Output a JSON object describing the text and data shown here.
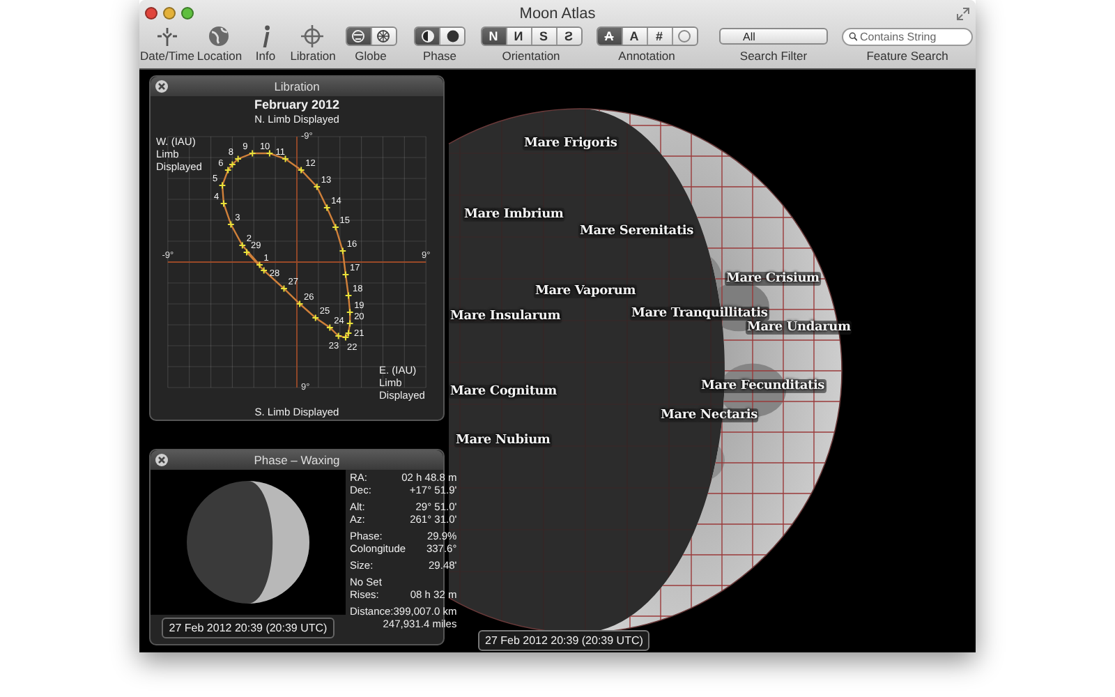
{
  "window": {
    "title": "Moon Atlas"
  },
  "toolbar": [
    {
      "kind": "button",
      "label": "Date/Time"
    },
    {
      "kind": "button",
      "label": "Location"
    },
    {
      "kind": "button",
      "label": "Info"
    },
    {
      "kind": "button",
      "label": "Libration"
    },
    {
      "kind": "segmented",
      "label": "Globe",
      "segments": [
        {
          "kind": "icon",
          "selected": true
        },
        {
          "kind": "icon",
          "selected": false
        }
      ]
    },
    {
      "kind": "segmented",
      "label": "Phase",
      "segments": [
        {
          "kind": "icon",
          "selected": true
        },
        {
          "kind": "icon",
          "selected": false
        }
      ]
    },
    {
      "kind": "segmented",
      "label": "Orientation",
      "segments": [
        {
          "kind": "text",
          "text": "N",
          "selected": true
        },
        {
          "kind": "text",
          "text": "И",
          "selected": false
        },
        {
          "kind": "text",
          "text": "S",
          "selected": false
        },
        {
          "kind": "text",
          "text": "Ƨ",
          "selected": false
        }
      ]
    },
    {
      "kind": "segmented",
      "label": "Annotation",
      "segments": [
        {
          "kind": "text",
          "text": "A",
          "struck": true,
          "selected": true
        },
        {
          "kind": "text",
          "text": "A",
          "struck": false,
          "selected": false
        },
        {
          "kind": "text",
          "text": "#",
          "struck": false,
          "selected": false
        },
        {
          "kind": "icon",
          "selected": false
        }
      ]
    },
    {
      "kind": "popup",
      "label": "Search Filter",
      "value": "All"
    },
    {
      "kind": "search",
      "label": "Feature Search",
      "placeholder": "Contains String"
    }
  ],
  "moon_labels": [
    "Mare Frigoris",
    "Mare Imbrium",
    "Mare Serenitatis",
    "Mare Vaporum",
    "Mare Crisium",
    "Mare Insularum",
    "Mare Tranquillitatis",
    "Mare Undarum",
    "Mare Fecunditatis",
    "Mare Cognitum",
    "Mare Nectaris",
    "Mare Nubium"
  ],
  "libration_panel": {
    "title": "Libration",
    "chart_data": {
      "type": "scatter",
      "title": "February 2012",
      "x": [
        -2.6,
        -3.8,
        -4.6,
        -5.1,
        -5.2,
        -4.8,
        -4.5,
        -4.1,
        -3.1,
        -1.9,
        -0.8,
        0.3,
        1.4,
        2.1,
        2.7,
        3.2,
        3.4,
        3.6,
        3.7,
        3.7,
        3.6,
        3.4,
        2.9,
        2.3,
        1.3,
        0.2,
        -0.9,
        -2.3,
        -3.5
      ],
      "series": [
        {
          "color": "#e8e23a",
          "values": [
            0.2,
            -1.2,
            -2.7,
            -4.2,
            -5.5,
            -6.6,
            -7.0,
            -7.4,
            -7.8,
            -7.8,
            -7.4,
            -6.6,
            -5.4,
            -3.9,
            -2.5,
            -0.8,
            0.9,
            2.4,
            3.6,
            4.4,
            5.1,
            5.4,
            5.3,
            4.7,
            4.0,
            3.0,
            1.9,
            0.6,
            -0.7
          ]
        }
      ],
      "value_labels": [
        "1",
        "2",
        "3",
        "4",
        "5",
        "6",
        null,
        "8",
        "9",
        "10",
        "11",
        "12",
        "13",
        "14",
        "15",
        "16",
        "17",
        "18",
        "19",
        "20",
        "21",
        "22",
        "23",
        "24",
        "25",
        "26",
        "27",
        "28",
        "29"
      ],
      "xlim": [
        -9,
        9
      ],
      "ylim": [
        9,
        -9
      ],
      "xticks": [
        {
          "value": -9,
          "label": "-9°"
        },
        {
          "value": 9,
          "label": "9°"
        }
      ],
      "yticks": [
        {
          "value": -9,
          "label": "-9°"
        },
        {
          "value": 9,
          "label": "9°"
        }
      ],
      "annotations": [
        {
          "text": "N. Limb Displayed"
        },
        {
          "text": "S. Limb Displayed"
        },
        {
          "text": "W. (IAU) Limb Displayed"
        },
        {
          "text": "E. (IAU) Limb Displayed"
        }
      ]
    }
  },
  "phase_panel": {
    "title": "Phase – Waxing",
    "date": "27 Feb 2012 20:39 (20:39 UTC)",
    "groups": [
      [
        {
          "label": "RA:",
          "value": "02 h 48.8 m"
        },
        {
          "label": "Dec:",
          "value": "+17° 51.9'"
        }
      ],
      [
        {
          "label": "Alt:",
          "value": "29° 51.0'"
        },
        {
          "label": "Az:",
          "value": "261° 31.0'"
        }
      ],
      [
        {
          "label": "Phase:",
          "value": "29.9%"
        },
        {
          "label": "Colongitude",
          "value": "337.6°"
        }
      ],
      [
        {
          "label": "Size:",
          "value": "29.48'"
        }
      ],
      [
        {
          "label": "No Set"
        },
        {
          "label": "Rises:",
          "value": "08 h 32 m"
        }
      ],
      [
        {
          "label": "Distance:",
          "value": "399,007.0 km"
        },
        {
          "value": "247,931.4 miles"
        }
      ]
    ]
  },
  "date_label": "27 Feb 2012 20:39 (20:39 UTC)"
}
